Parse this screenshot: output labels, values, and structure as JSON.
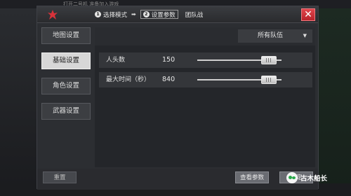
{
  "background": {
    "hint_text": "打开二号机 准备加入游戏"
  },
  "dialog": {
    "steps": [
      {
        "num": "1",
        "label": "选择模式"
      },
      {
        "num": "2",
        "label": "设置参数"
      },
      {
        "label": "团队战"
      }
    ],
    "close_label": "✕",
    "sidebar": {
      "items": [
        {
          "label": "地图设置"
        },
        {
          "label": "基础设置"
        },
        {
          "label": "角色设置"
        },
        {
          "label": "武器设置"
        }
      ]
    },
    "filter": {
      "selected": "所有队伍"
    },
    "rows": [
      {
        "label": "人头数",
        "value": "150",
        "slider_fraction": 0.85
      },
      {
        "label": "最大时间（秒）",
        "value": "840",
        "slider_fraction": 0.85
      }
    ],
    "footer": {
      "reset_label": "重置",
      "view_label": "查看参数",
      "confirm_label": "确定"
    }
  },
  "watermark": {
    "text": "古木船长"
  },
  "colors": {
    "accent_red": "#d8323a",
    "active_tab": "#d7d7d7"
  }
}
